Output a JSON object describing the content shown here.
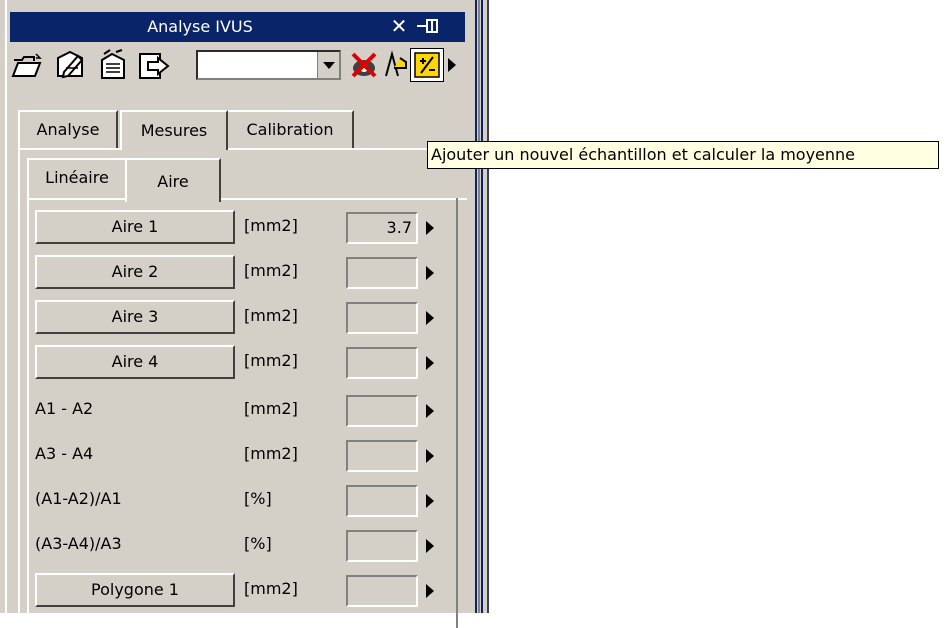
{
  "window": {
    "title": "Analyse IVUS",
    "close_glyph": "✕",
    "pin_icon": "pin-icon"
  },
  "toolbar": {
    "icons": [
      "open-folder-icon",
      "edit-icon",
      "delete-icon",
      "export-icon",
      "no-view-icon",
      "zoom-icon",
      "add-sample-icon"
    ],
    "combo_value": ""
  },
  "tabs_main": [
    {
      "label": "Analyse",
      "active": false
    },
    {
      "label": "Mesures",
      "active": true
    },
    {
      "label": "Calibration",
      "active": false
    }
  ],
  "tabs_sub": [
    {
      "label": "Linéaire",
      "active": false
    },
    {
      "label": "Aire",
      "active": true
    }
  ],
  "rows": [
    {
      "label": "Aire 1",
      "is_button": true,
      "unit": "[mm2]",
      "value": "3.7"
    },
    {
      "label": "Aire 2",
      "is_button": true,
      "unit": "[mm2]",
      "value": ""
    },
    {
      "label": "Aire 3",
      "is_button": true,
      "unit": "[mm2]",
      "value": ""
    },
    {
      "label": "Aire 4",
      "is_button": true,
      "unit": "[mm2]",
      "value": ""
    },
    {
      "label": "A1 - A2",
      "is_button": false,
      "unit": "[mm2]",
      "value": ""
    },
    {
      "label": "A3 - A4",
      "is_button": false,
      "unit": "[mm2]",
      "value": ""
    },
    {
      "label": "(A1-A2)/A1",
      "is_button": false,
      "unit": "[%]",
      "value": ""
    },
    {
      "label": "(A3-A4)/A3",
      "is_button": false,
      "unit": "[%]",
      "value": ""
    },
    {
      "label": "Polygone 1",
      "is_button": true,
      "unit": "[mm2]",
      "value": ""
    }
  ],
  "tooltip": "Ajouter un nouvel échantillon et calculer la moyenne",
  "colors": {
    "titlebar": "#0a246a",
    "face": "#d4d0c8",
    "tooltip_bg": "#ffffe1"
  }
}
